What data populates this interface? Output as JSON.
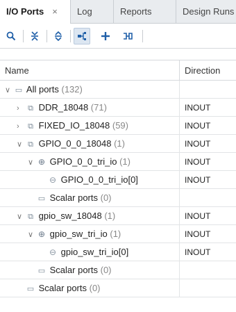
{
  "tabs": [
    {
      "label": "I/O Ports",
      "close": "×"
    },
    {
      "label": "Log"
    },
    {
      "label": "Reports"
    },
    {
      "label": "Design Runs"
    }
  ],
  "toolbar": {
    "icons": [
      "search-icon",
      "collapse-all-icon",
      "expand-all-icon",
      "group-icon",
      "add-icon",
      "schematic-icon"
    ]
  },
  "columns": {
    "name": "Name",
    "direction": "Direction"
  },
  "rows": [
    {
      "label": "All ports",
      "count": "(132)",
      "direction": ""
    },
    {
      "label": "DDR_18048",
      "count": "(71)",
      "direction": "INOUT"
    },
    {
      "label": "FIXED_IO_18048",
      "count": "(59)",
      "direction": "INOUT"
    },
    {
      "label": "GPIO_0_0_18048",
      "count": "(1)",
      "direction": "INOUT"
    },
    {
      "label": "GPIO_0_0_tri_io",
      "count": "(1)",
      "direction": "INOUT"
    },
    {
      "label": "GPIO_0_0_tri_io[0]",
      "count": "",
      "direction": "INOUT"
    },
    {
      "label": "Scalar ports",
      "count": "(0)",
      "direction": ""
    },
    {
      "label": "gpio_sw_18048",
      "count": "(1)",
      "direction": "INOUT"
    },
    {
      "label": "gpio_sw_tri_io",
      "count": "(1)",
      "direction": "INOUT"
    },
    {
      "label": "gpio_sw_tri_io[0]",
      "count": "",
      "direction": "INOUT"
    },
    {
      "label": "Scalar ports",
      "count": "(0)",
      "direction": ""
    },
    {
      "label": "Scalar ports",
      "count": "(0)",
      "direction": ""
    }
  ]
}
